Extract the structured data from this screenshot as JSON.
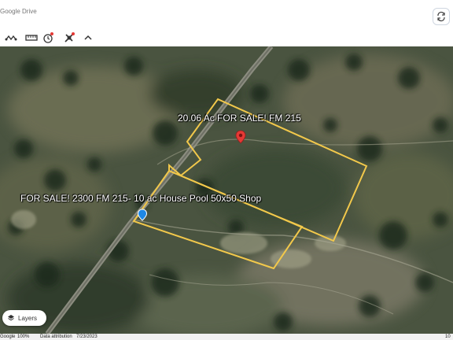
{
  "top_bar": {
    "breadcrumb": "Google Drive"
  },
  "toolbar": {
    "items": [
      {
        "icon": "route-icon"
      },
      {
        "icon": "ruler-icon"
      },
      {
        "icon": "history-icon"
      },
      {
        "icon": "satellite-icon"
      },
      {
        "icon": "chevron-up-icon"
      }
    ]
  },
  "map": {
    "labels": {
      "parcel_north": "20.06 Ac FOR SALE! FM 215",
      "parcel_south": "FOR SALE! 2300 FM 215- 10 ac House Pool 50x50 Shop"
    },
    "boundary_color": "#f2c84b",
    "pin_red": "#e53935",
    "pin_blue": "#1e88e5"
  },
  "layers_button": {
    "label": "Layers"
  },
  "status_bar": {
    "brand": "Google",
    "zoom": "100%",
    "data_attribution": "Data attribution",
    "date": "7/23/2023",
    "scale_fragment": "10"
  }
}
